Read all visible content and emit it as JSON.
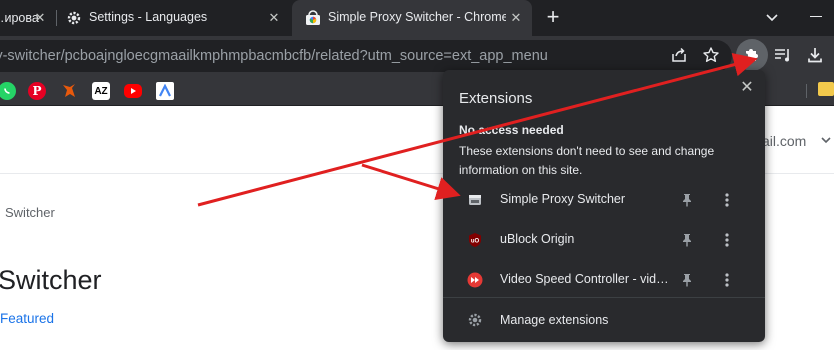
{
  "tabs": [
    {
      "title": "…ирова",
      "active": false
    },
    {
      "title": "Settings - Languages",
      "active": false
    },
    {
      "title": "Simple Proxy Switcher - Chrome",
      "active": true
    }
  ],
  "toolbar": {
    "url": "oxy-switcher/pcboajngloecgmaailkmphmpbacmbcfb/related?utm_source=ext_app_menu"
  },
  "bookmarks": [
    {
      "icon": "whatsapp-icon",
      "color": "#25d366",
      "text": ""
    },
    {
      "icon": "pinterest-icon",
      "color": "#e60023",
      "text": "P"
    },
    {
      "icon": "fox-icon",
      "color": "#e8590c",
      "text": ""
    },
    {
      "icon": "az-icon",
      "color": "#ffffff",
      "text": "AZ"
    },
    {
      "icon": "youtube-icon",
      "color": "#ff0000",
      "text": ""
    },
    {
      "icon": "translate-icon",
      "color": "#4285f4",
      "text": ""
    }
  ],
  "page": {
    "account": "ail.com",
    "breadcrumb": "Switcher",
    "title": "Switcher",
    "featured": "Featured"
  },
  "popup": {
    "title": "Extensions",
    "section_heading": "No access needed",
    "section_description": "These extensions don't need to see and change information on this site.",
    "extensions": [
      {
        "name": "Simple Proxy Switcher",
        "icon": "proxy-switcher-icon"
      },
      {
        "name": "uBlock Origin",
        "icon": "ublock-icon"
      },
      {
        "name": "Video Speed Controller - vide…",
        "icon": "video-speed-icon"
      }
    ],
    "manage_label": "Manage extensions"
  },
  "colors": {
    "tabstrip": "#202124",
    "toolbar": "#35363a",
    "popup": "#292a2d",
    "annotation": "#e02020",
    "link": "#1a73e8"
  }
}
